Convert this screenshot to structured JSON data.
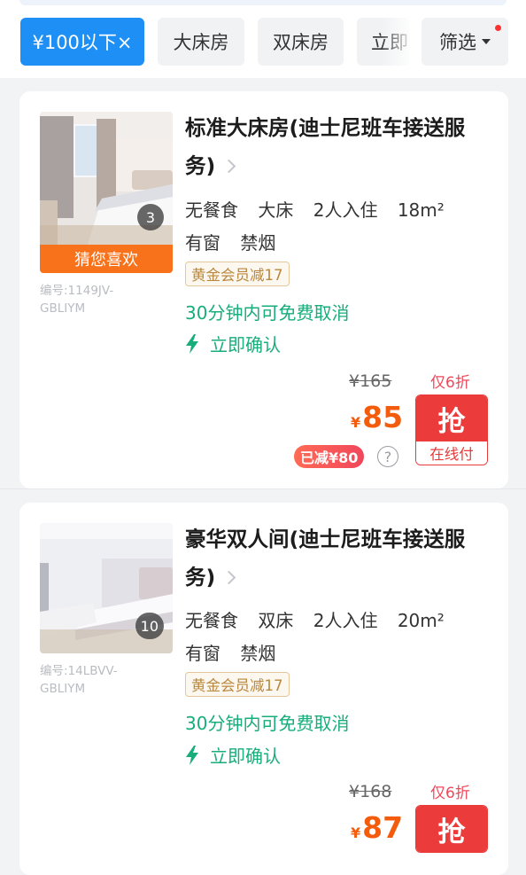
{
  "filters": {
    "active": "¥100以下×",
    "chip2": "大床房",
    "chip3": "双床房",
    "chip4": "立即",
    "filter": "筛选"
  },
  "rooms": [
    {
      "title": "标准大床房(迪士尼班车接送服务)",
      "photo_count": "3",
      "guess_tag": "猜您喜欢",
      "code": "编号:1149JV-GBLIYM",
      "meal": "无餐食",
      "bed": "大床",
      "guests": "2人入住",
      "area": "18m²",
      "window": "有窗",
      "smoke": "禁烟",
      "badge": "黄金会员减17",
      "cancel": "30分钟内可免费取消",
      "confirm": "立即确认",
      "old_price": "¥165",
      "currency": "¥",
      "price": "85",
      "discount": "仅6折",
      "reduced": "已减¥80",
      "grab": "抢",
      "pay": "在线付"
    },
    {
      "title": "豪华双人间(迪士尼班车接送服务)",
      "photo_count": "10",
      "code": "编号:14LBVV-GBLIYM",
      "meal": "无餐食",
      "bed": "双床",
      "guests": "2人入住",
      "area": "20m²",
      "window": "有窗",
      "smoke": "禁烟",
      "badge": "黄金会员减17",
      "cancel": "30分钟内可免费取消",
      "confirm": "立即确认",
      "old_price": "¥168",
      "currency": "¥",
      "price": "87",
      "discount": "仅6折",
      "grab": "抢"
    }
  ],
  "icons": {
    "bolt": "lightning-bolt-icon",
    "chevron": "chevron-right-icon",
    "help": "question-circle-icon",
    "caret": "caret-down-icon"
  },
  "colors": {
    "accent": "#1e90f5",
    "green": "#19ad7c",
    "price": "#f25c0c",
    "grab": "#ec3b3b"
  }
}
